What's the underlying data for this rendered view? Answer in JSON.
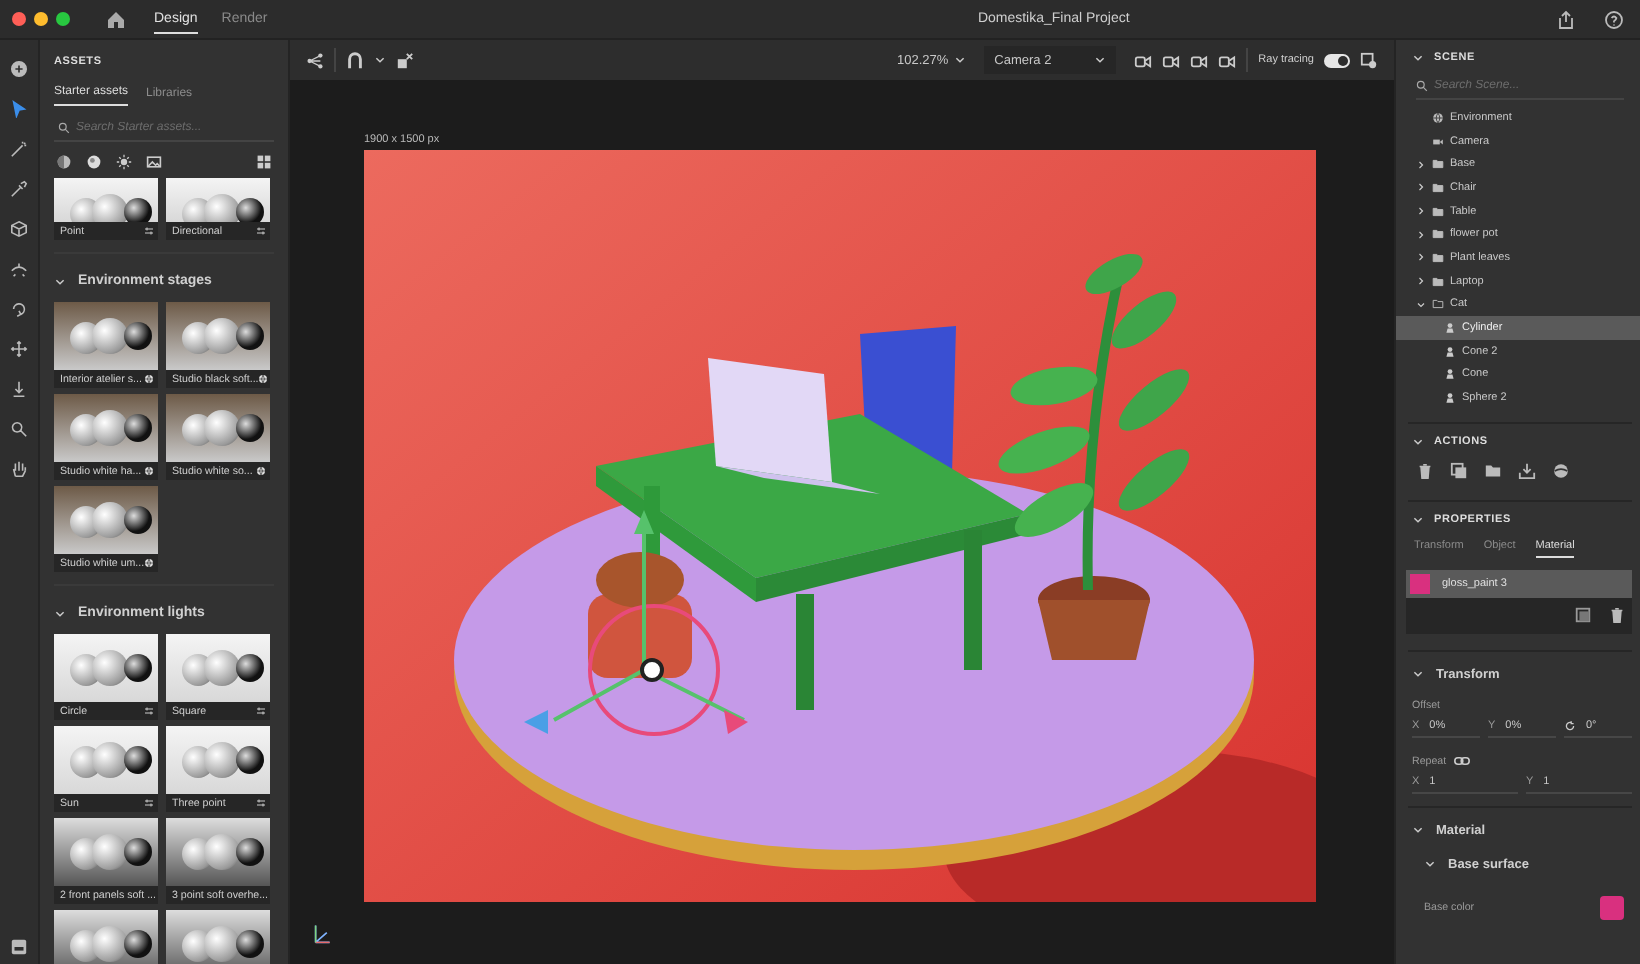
{
  "window": {
    "title": "Domestika_Final Project"
  },
  "mode_tabs": [
    {
      "label": "Design",
      "selected": true
    },
    {
      "label": "Render",
      "selected": false
    }
  ],
  "tools": [
    {
      "kind": "add",
      "selected": false
    },
    {
      "kind": "select",
      "selected": true
    },
    {
      "kind": "wand",
      "selected": false
    },
    {
      "kind": "dropper",
      "selected": false
    },
    {
      "kind": "cube",
      "selected": false
    },
    {
      "kind": "orbit",
      "selected": false
    },
    {
      "kind": "rotate",
      "selected": false
    },
    {
      "kind": "move",
      "selected": false
    },
    {
      "kind": "drop",
      "selected": false
    },
    {
      "kind": "zoom",
      "selected": false
    },
    {
      "kind": "hand",
      "selected": false
    }
  ],
  "assets": {
    "title": "ASSETS",
    "tabs": [
      {
        "label": "Starter assets",
        "selected": true
      },
      {
        "label": "Libraries",
        "selected": false
      }
    ],
    "search": {
      "placeholder": "Search Starter assets..."
    },
    "sections": [
      {
        "items": [
          {
            "label": "Point",
            "kind": "light"
          },
          {
            "label": "Directional",
            "kind": "light"
          }
        ]
      },
      {
        "title": "Environment stages",
        "expanded": true,
        "items": [
          {
            "label": "Interior atelier s...",
            "kind": "environment"
          },
          {
            "label": "Studio black soft...",
            "kind": "environment"
          },
          {
            "label": "Studio white ha...",
            "kind": "environment"
          },
          {
            "label": "Studio white so...",
            "kind": "environment"
          },
          {
            "label": "Studio white um...",
            "kind": "environment"
          }
        ]
      },
      {
        "title": "Environment lights",
        "expanded": true,
        "items": [
          {
            "label": "Circle",
            "kind": "light"
          },
          {
            "label": "Square",
            "kind": "light"
          },
          {
            "label": "Sun",
            "kind": "light"
          },
          {
            "label": "Three point",
            "kind": "light"
          },
          {
            "label": "2 front panels soft ...",
            "kind": "plain"
          },
          {
            "label": "3 point soft overhe...",
            "kind": "plain"
          },
          {
            "kind": "partial"
          },
          {
            "kind": "partial"
          }
        ]
      }
    ]
  },
  "viewport": {
    "zoom": "102.27%",
    "camera": "Camera 2",
    "ray_tracing": {
      "label": "Ray tracing",
      "on": true
    },
    "canvas_size": "1900 x 1500 px"
  },
  "scene": {
    "title": "SCENE",
    "search": {
      "placeholder": "Search Scene..."
    },
    "items": [
      {
        "label": "Environment",
        "kind": "environment",
        "selected": false
      },
      {
        "label": "Camera",
        "kind": "camera",
        "selected": false
      },
      {
        "label": "Base",
        "kind": "group",
        "expanded": false,
        "selected": false
      },
      {
        "label": "Chair",
        "kind": "group",
        "expanded": false,
        "selected": false
      },
      {
        "label": "Table",
        "kind": "group",
        "expanded": false,
        "selected": false
      },
      {
        "label": "flower pot",
        "kind": "group",
        "expanded": false,
        "selected": false
      },
      {
        "label": "Plant leaves",
        "kind": "group",
        "expanded": false,
        "selected": false
      },
      {
        "label": "Laptop",
        "kind": "group",
        "expanded": false,
        "selected": false
      },
      {
        "label": "Cat",
        "kind": "group",
        "expanded": true,
        "selected": false,
        "children": [
          {
            "label": "Cylinder",
            "kind": "object",
            "selected": true
          },
          {
            "label": "Cone 2",
            "kind": "object",
            "selected": false
          },
          {
            "label": "Cone",
            "kind": "object",
            "selected": false
          },
          {
            "label": "Sphere 2",
            "kind": "object",
            "selected": false
          }
        ]
      }
    ]
  },
  "actions": {
    "title": "ACTIONS"
  },
  "properties": {
    "title": "PROPERTIES",
    "tabs": [
      {
        "label": "Transform",
        "selected": false
      },
      {
        "label": "Object",
        "selected": false
      },
      {
        "label": "Material",
        "selected": true
      }
    ],
    "material": {
      "name": "gloss_paint 3",
      "color": "#d9307f"
    },
    "transform": {
      "title": "Transform",
      "offset_label": "Offset",
      "offset": [
        {
          "axis": "X",
          "value": "0%"
        },
        {
          "axis": "Y",
          "value": "0%"
        }
      ],
      "rotation": "0°",
      "repeat_label": "Repeat",
      "repeat": [
        {
          "axis": "X",
          "value": "1"
        },
        {
          "axis": "Y",
          "value": "1"
        }
      ]
    },
    "material_section": {
      "title": "Material",
      "subsection": "Base surface",
      "base_color_label": "Base color"
    }
  }
}
